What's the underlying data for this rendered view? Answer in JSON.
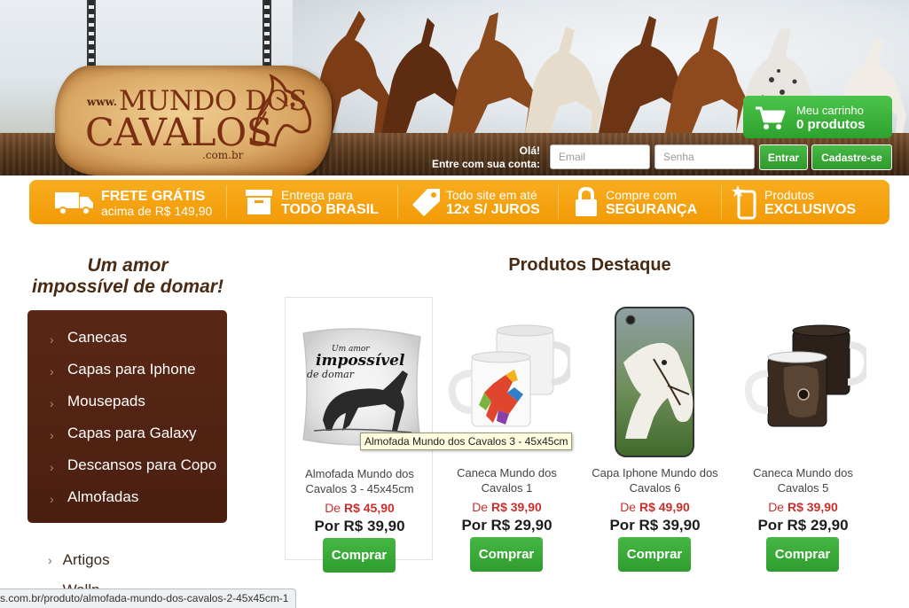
{
  "header": {
    "logo": {
      "www": "www.",
      "line1": "MUNDO DOS",
      "line2": "CAVALOS",
      "suffix": ".com.br"
    },
    "cart": {
      "line1": "Meu carrinho",
      "line2": "0 produtos",
      "icon": "shopping-cart-icon"
    },
    "login": {
      "greeting": "Olá!",
      "prompt": "Entre com sua conta:",
      "email_placeholder": "Email",
      "password_placeholder": "Senha",
      "login_button": "Entrar",
      "signup_button": "Cadastre-se"
    }
  },
  "benefits": [
    {
      "icon": "truck-icon",
      "top": "FRETE GRÁTIS",
      "bottom": "acima de R$ 149,90"
    },
    {
      "icon": "box-icon",
      "top": "Entrega para",
      "bottom": "TODO BRASIL"
    },
    {
      "icon": "tag-icon",
      "top": "Todo site em até",
      "bottom": "12x S/ JUROS"
    },
    {
      "icon": "lock-icon",
      "top": "Compre com",
      "bottom": "SEGURANÇA"
    },
    {
      "icon": "phone-star-icon",
      "top": "Produtos",
      "bottom": "EXCLUSIVOS"
    }
  ],
  "sidebar": {
    "slogan_line1": "Um amor",
    "slogan_line2": "impossível de domar!",
    "menu": [
      "Canecas",
      "Capas para Iphone",
      "Mousepads",
      "Capas para Galaxy",
      "Descansos para Copo",
      "Almofadas"
    ],
    "links": [
      "Artigos",
      "Wallp..."
    ]
  },
  "featured": {
    "title": "Produtos Destaque",
    "products": [
      {
        "name": "Almofada Mundo dos Cavalos 3 - 45x45cm",
        "old_prefix": "De ",
        "old_price": "R$ 45,90",
        "new_price": "Por R$ 39,90",
        "buy": "Comprar",
        "image": "pillow-horse-image"
      },
      {
        "name": "Caneca Mundo dos Cavalos 1",
        "old_prefix": "De ",
        "old_price": "R$ 39,90",
        "new_price": "Por R$ 29,90",
        "buy": "Comprar",
        "image": "mug-colorful-horse-image"
      },
      {
        "name": "Capa Iphone Mundo dos Cavalos 6",
        "old_prefix": "De ",
        "old_price": "R$ 49,90",
        "new_price": "Por R$ 39,90",
        "buy": "Comprar",
        "image": "phone-case-white-horse-image"
      },
      {
        "name": "Caneca Mundo dos Cavalos 5",
        "old_prefix": "De ",
        "old_price": "R$ 39,90",
        "new_price": "Por R$ 29,90",
        "buy": "Comprar",
        "image": "mug-dark-horse-image"
      }
    ]
  },
  "tooltip": "Almofada Mundo dos Cavalos 3 - 45x45cm",
  "status_bar": "s.com.br/produto/almofada-mundo-dos-cavalos-2-45x45cm-1",
  "colors": {
    "orange": "#f5a10f",
    "brown": "#4a1f10",
    "green": "#34a532",
    "price_red": "#c9302c"
  }
}
